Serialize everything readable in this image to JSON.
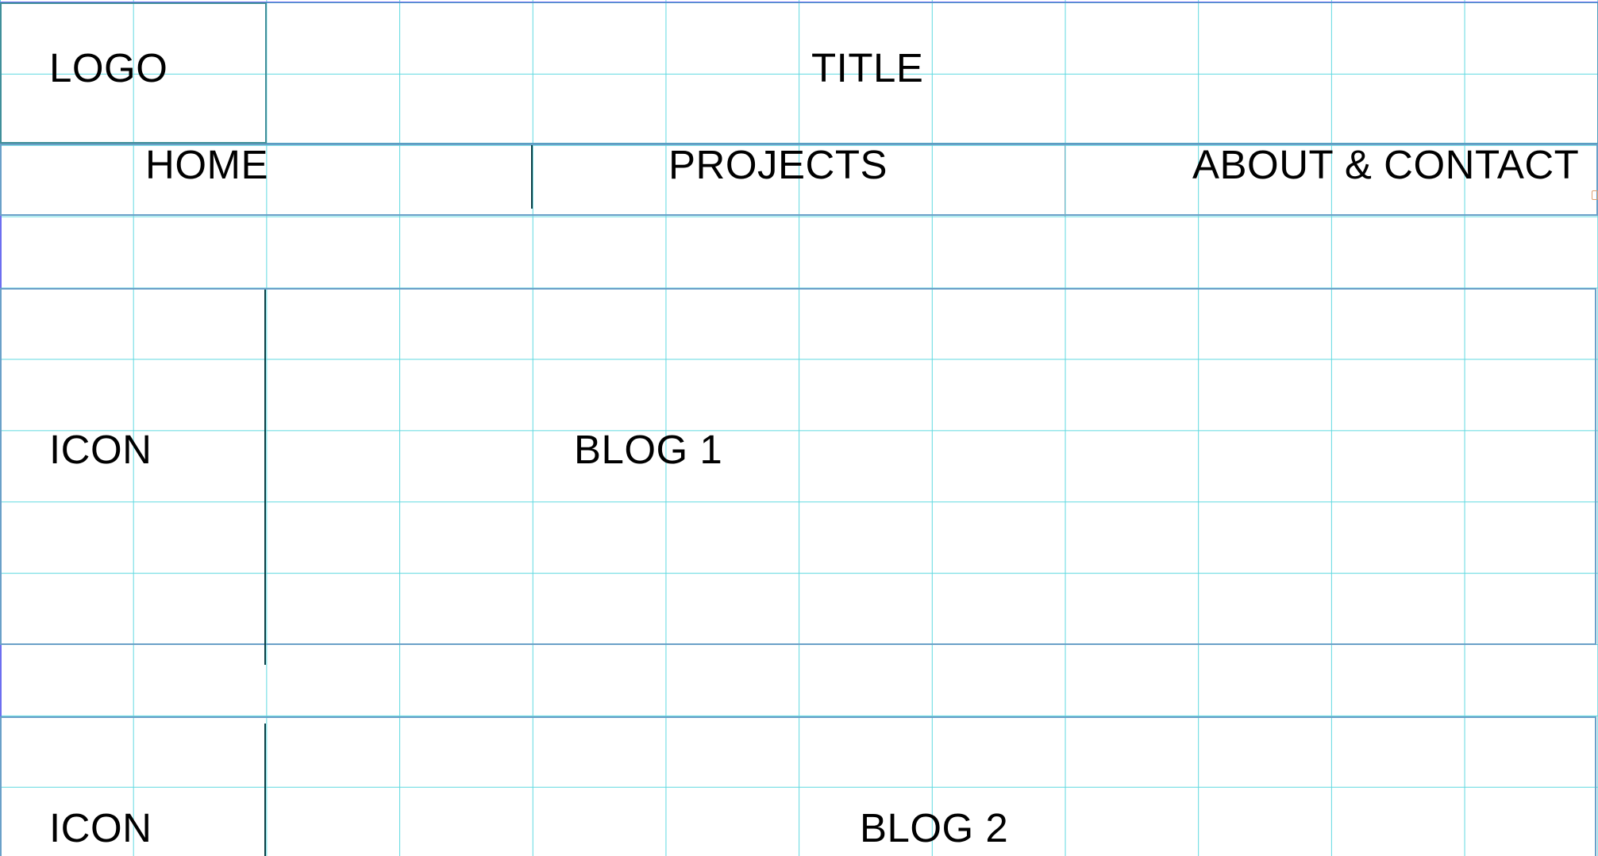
{
  "header": {
    "logo": "LOGO",
    "title": "TITLE"
  },
  "nav": {
    "home": "HOME",
    "projects": "PROJECTS",
    "about_contact": "ABOUT & CONTACT"
  },
  "posts": [
    {
      "icon": "ICON",
      "title": "BLOG 1"
    },
    {
      "icon": "ICON",
      "title": "BLOG 2"
    }
  ],
  "colors": {
    "grid": "#5fd9e0",
    "page_border": "#6d6ef0",
    "divider": "#0a3f46"
  }
}
